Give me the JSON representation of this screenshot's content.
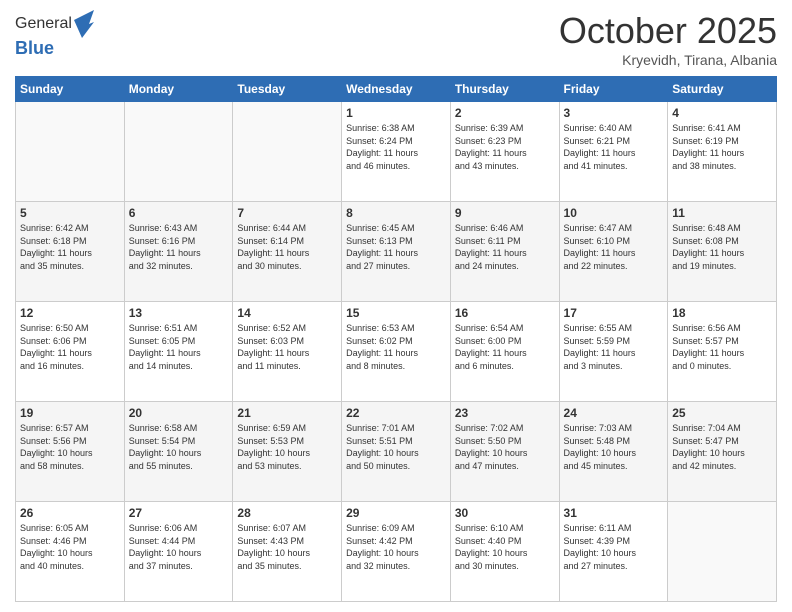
{
  "header": {
    "logo_line1": "General",
    "logo_line2": "Blue",
    "month_title": "October 2025",
    "location": "Kryevidh, Tirana, Albania"
  },
  "days_of_week": [
    "Sunday",
    "Monday",
    "Tuesday",
    "Wednesday",
    "Thursday",
    "Friday",
    "Saturday"
  ],
  "weeks": [
    [
      {
        "day": "",
        "info": ""
      },
      {
        "day": "",
        "info": ""
      },
      {
        "day": "",
        "info": ""
      },
      {
        "day": "1",
        "info": "Sunrise: 6:38 AM\nSunset: 6:24 PM\nDaylight: 11 hours\nand 46 minutes."
      },
      {
        "day": "2",
        "info": "Sunrise: 6:39 AM\nSunset: 6:23 PM\nDaylight: 11 hours\nand 43 minutes."
      },
      {
        "day": "3",
        "info": "Sunrise: 6:40 AM\nSunset: 6:21 PM\nDaylight: 11 hours\nand 41 minutes."
      },
      {
        "day": "4",
        "info": "Sunrise: 6:41 AM\nSunset: 6:19 PM\nDaylight: 11 hours\nand 38 minutes."
      }
    ],
    [
      {
        "day": "5",
        "info": "Sunrise: 6:42 AM\nSunset: 6:18 PM\nDaylight: 11 hours\nand 35 minutes."
      },
      {
        "day": "6",
        "info": "Sunrise: 6:43 AM\nSunset: 6:16 PM\nDaylight: 11 hours\nand 32 minutes."
      },
      {
        "day": "7",
        "info": "Sunrise: 6:44 AM\nSunset: 6:14 PM\nDaylight: 11 hours\nand 30 minutes."
      },
      {
        "day": "8",
        "info": "Sunrise: 6:45 AM\nSunset: 6:13 PM\nDaylight: 11 hours\nand 27 minutes."
      },
      {
        "day": "9",
        "info": "Sunrise: 6:46 AM\nSunset: 6:11 PM\nDaylight: 11 hours\nand 24 minutes."
      },
      {
        "day": "10",
        "info": "Sunrise: 6:47 AM\nSunset: 6:10 PM\nDaylight: 11 hours\nand 22 minutes."
      },
      {
        "day": "11",
        "info": "Sunrise: 6:48 AM\nSunset: 6:08 PM\nDaylight: 11 hours\nand 19 minutes."
      }
    ],
    [
      {
        "day": "12",
        "info": "Sunrise: 6:50 AM\nSunset: 6:06 PM\nDaylight: 11 hours\nand 16 minutes."
      },
      {
        "day": "13",
        "info": "Sunrise: 6:51 AM\nSunset: 6:05 PM\nDaylight: 11 hours\nand 14 minutes."
      },
      {
        "day": "14",
        "info": "Sunrise: 6:52 AM\nSunset: 6:03 PM\nDaylight: 11 hours\nand 11 minutes."
      },
      {
        "day": "15",
        "info": "Sunrise: 6:53 AM\nSunset: 6:02 PM\nDaylight: 11 hours\nand 8 minutes."
      },
      {
        "day": "16",
        "info": "Sunrise: 6:54 AM\nSunset: 6:00 PM\nDaylight: 11 hours\nand 6 minutes."
      },
      {
        "day": "17",
        "info": "Sunrise: 6:55 AM\nSunset: 5:59 PM\nDaylight: 11 hours\nand 3 minutes."
      },
      {
        "day": "18",
        "info": "Sunrise: 6:56 AM\nSunset: 5:57 PM\nDaylight: 11 hours\nand 0 minutes."
      }
    ],
    [
      {
        "day": "19",
        "info": "Sunrise: 6:57 AM\nSunset: 5:56 PM\nDaylight: 10 hours\nand 58 minutes."
      },
      {
        "day": "20",
        "info": "Sunrise: 6:58 AM\nSunset: 5:54 PM\nDaylight: 10 hours\nand 55 minutes."
      },
      {
        "day": "21",
        "info": "Sunrise: 6:59 AM\nSunset: 5:53 PM\nDaylight: 10 hours\nand 53 minutes."
      },
      {
        "day": "22",
        "info": "Sunrise: 7:01 AM\nSunset: 5:51 PM\nDaylight: 10 hours\nand 50 minutes."
      },
      {
        "day": "23",
        "info": "Sunrise: 7:02 AM\nSunset: 5:50 PM\nDaylight: 10 hours\nand 47 minutes."
      },
      {
        "day": "24",
        "info": "Sunrise: 7:03 AM\nSunset: 5:48 PM\nDaylight: 10 hours\nand 45 minutes."
      },
      {
        "day": "25",
        "info": "Sunrise: 7:04 AM\nSunset: 5:47 PM\nDaylight: 10 hours\nand 42 minutes."
      }
    ],
    [
      {
        "day": "26",
        "info": "Sunrise: 6:05 AM\nSunset: 4:46 PM\nDaylight: 10 hours\nand 40 minutes."
      },
      {
        "day": "27",
        "info": "Sunrise: 6:06 AM\nSunset: 4:44 PM\nDaylight: 10 hours\nand 37 minutes."
      },
      {
        "day": "28",
        "info": "Sunrise: 6:07 AM\nSunset: 4:43 PM\nDaylight: 10 hours\nand 35 minutes."
      },
      {
        "day": "29",
        "info": "Sunrise: 6:09 AM\nSunset: 4:42 PM\nDaylight: 10 hours\nand 32 minutes."
      },
      {
        "day": "30",
        "info": "Sunrise: 6:10 AM\nSunset: 4:40 PM\nDaylight: 10 hours\nand 30 minutes."
      },
      {
        "day": "31",
        "info": "Sunrise: 6:11 AM\nSunset: 4:39 PM\nDaylight: 10 hours\nand 27 minutes."
      },
      {
        "day": "",
        "info": ""
      }
    ]
  ]
}
